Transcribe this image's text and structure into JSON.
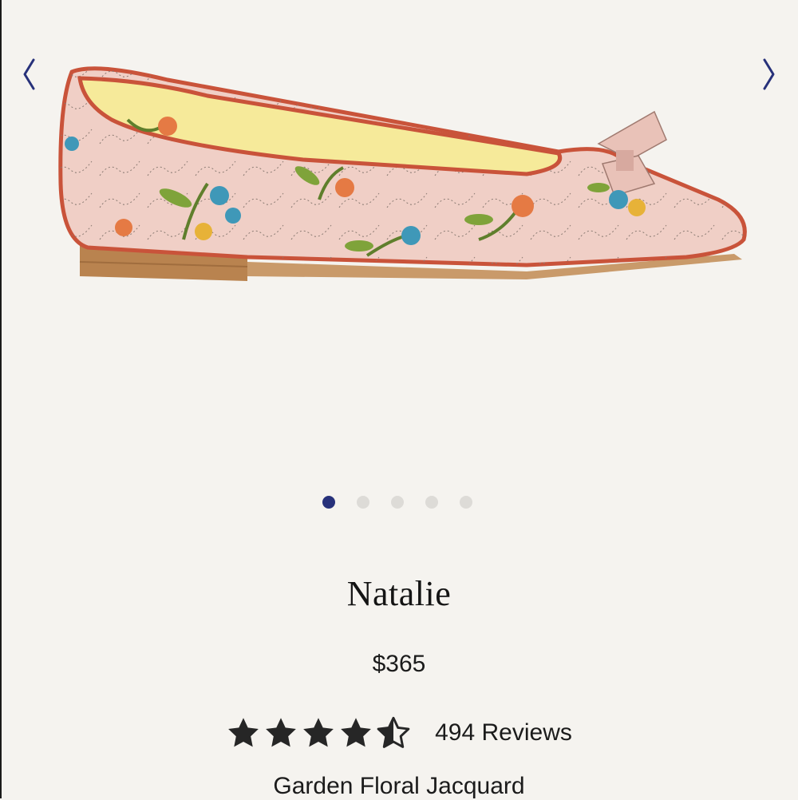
{
  "carousel": {
    "prev_icon": "chevron-left-icon",
    "next_icon": "chevron-right-icon",
    "image_alt": "pink floral jacquard pointed flat with bow",
    "dots_count": 5,
    "active_index": 0,
    "accent_color": "#27317a"
  },
  "product": {
    "name": "Natalie",
    "price": "$365",
    "rating": 4.5,
    "reviews_label": "494 Reviews",
    "material": "Garden Floral Jacquard"
  }
}
